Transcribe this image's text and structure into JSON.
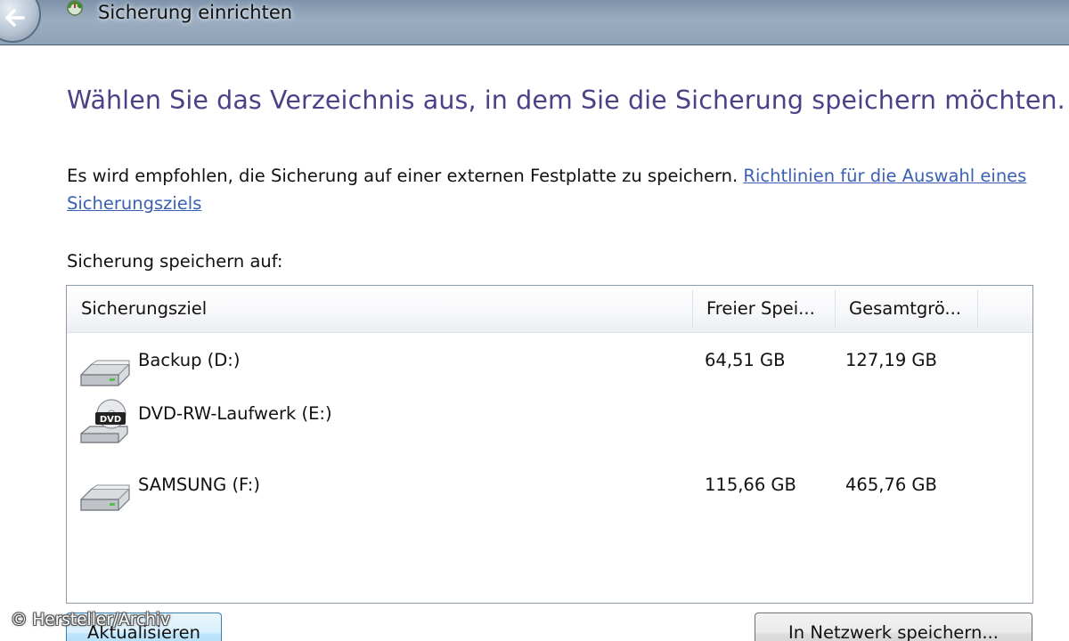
{
  "window": {
    "title": "Sicherung einrichten",
    "back_icon": "back-arrow-icon",
    "app_icon": "backup-app-icon"
  },
  "main": {
    "heading": "Wählen Sie das Verzeichnis aus, in dem Sie die Sicherung speichern möchten.",
    "recommendation_text": "Es wird empfohlen, die Sicherung auf einer externen Festplatte zu speichern. ",
    "guidelines_link": "Richtlinien für die Auswahl eines Sicherungsziels",
    "save_to_label": "Sicherung speichern auf:"
  },
  "table": {
    "columns": [
      "Sicherungsziel",
      "Freier Spei...",
      "Gesamtgrö..."
    ],
    "rows": [
      {
        "name": "Backup (D:)",
        "free": "64,51 GB",
        "total": "127,19 GB",
        "icon": "hard-drive-icon"
      },
      {
        "name": "DVD-RW-Laufwerk (E:)",
        "free": "",
        "total": "",
        "icon": "dvd-drive-icon"
      },
      {
        "name": "SAMSUNG (F:)",
        "free": "115,66 GB",
        "total": "465,76 GB",
        "icon": "hard-drive-icon"
      }
    ]
  },
  "buttons": {
    "refresh": "Aktualisieren",
    "network": "In Netzwerk speichern..."
  },
  "watermark": "© Hersteller/Archiv",
  "colors": {
    "heading": "#4e3f86",
    "link": "#3b61b2",
    "titlebar": "#9aacc0"
  }
}
